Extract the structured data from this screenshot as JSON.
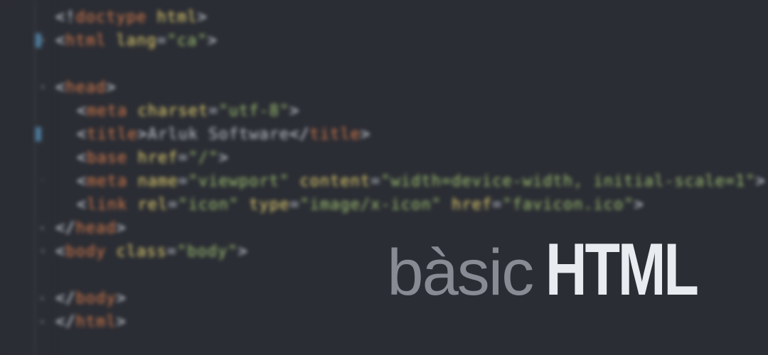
{
  "overlay": {
    "word1": "bàsic",
    "word2": "HTML"
  },
  "code": {
    "lines": [
      {
        "indent": 0,
        "segments": [
          {
            "cls": "bracket",
            "t": "<!"
          },
          {
            "cls": "tag",
            "t": "doctype "
          },
          {
            "cls": "attr-name",
            "t": "html"
          },
          {
            "cls": "bracket",
            "t": ">"
          }
        ]
      },
      {
        "indent": 0,
        "segments": [
          {
            "cls": "bracket",
            "t": "<"
          },
          {
            "cls": "tag",
            "t": "html "
          },
          {
            "cls": "attr-name",
            "t": "lang"
          },
          {
            "cls": "attr-eq",
            "t": "="
          },
          {
            "cls": "attr-val",
            "t": "\"ca\""
          },
          {
            "cls": "bracket",
            "t": ">"
          }
        ]
      },
      {
        "indent": 0,
        "segments": []
      },
      {
        "indent": 0,
        "segments": [
          {
            "cls": "bracket",
            "t": "<"
          },
          {
            "cls": "tag",
            "t": "head"
          },
          {
            "cls": "bracket",
            "t": ">"
          }
        ]
      },
      {
        "indent": 1,
        "segments": [
          {
            "cls": "bracket",
            "t": "<"
          },
          {
            "cls": "tag",
            "t": "meta "
          },
          {
            "cls": "attr-name",
            "t": "charset"
          },
          {
            "cls": "attr-eq",
            "t": "="
          },
          {
            "cls": "attr-val",
            "t": "\"utf-8\""
          },
          {
            "cls": "bracket",
            "t": ">"
          }
        ]
      },
      {
        "indent": 1,
        "segments": [
          {
            "cls": "bracket",
            "t": "<"
          },
          {
            "cls": "tag",
            "t": "title"
          },
          {
            "cls": "bracket",
            "t": ">"
          },
          {
            "cls": "text-content",
            "t": "Arluk Software"
          },
          {
            "cls": "bracket",
            "t": "</"
          },
          {
            "cls": "tag",
            "t": "title"
          },
          {
            "cls": "bracket",
            "t": ">"
          }
        ]
      },
      {
        "indent": 1,
        "segments": [
          {
            "cls": "bracket",
            "t": "<"
          },
          {
            "cls": "tag",
            "t": "base "
          },
          {
            "cls": "attr-name",
            "t": "href"
          },
          {
            "cls": "attr-eq",
            "t": "="
          },
          {
            "cls": "attr-val",
            "t": "\"/\""
          },
          {
            "cls": "bracket",
            "t": ">"
          }
        ]
      },
      {
        "indent": 1,
        "segments": [
          {
            "cls": "bracket",
            "t": "<"
          },
          {
            "cls": "tag",
            "t": "meta "
          },
          {
            "cls": "attr-name",
            "t": "name"
          },
          {
            "cls": "attr-eq",
            "t": "="
          },
          {
            "cls": "attr-val",
            "t": "\"viewport\" "
          },
          {
            "cls": "attr-name",
            "t": "content"
          },
          {
            "cls": "attr-eq",
            "t": "="
          },
          {
            "cls": "attr-val",
            "t": "\"width=device-width, initial-scale=1\""
          },
          {
            "cls": "bracket",
            "t": ">"
          }
        ]
      },
      {
        "indent": 1,
        "segments": [
          {
            "cls": "bracket",
            "t": "<"
          },
          {
            "cls": "tag",
            "t": "link "
          },
          {
            "cls": "attr-name",
            "t": "rel"
          },
          {
            "cls": "attr-eq",
            "t": "="
          },
          {
            "cls": "attr-val",
            "t": "\"icon\" "
          },
          {
            "cls": "attr-name",
            "t": "type"
          },
          {
            "cls": "attr-eq",
            "t": "="
          },
          {
            "cls": "attr-val",
            "t": "\"image/x-icon\" "
          },
          {
            "cls": "attr-name",
            "t": "href"
          },
          {
            "cls": "attr-eq",
            "t": "="
          },
          {
            "cls": "attr-val",
            "t": "\"favicon.ico\""
          },
          {
            "cls": "bracket",
            "t": ">"
          }
        ]
      },
      {
        "indent": 0,
        "segments": [
          {
            "cls": "bracket",
            "t": "</"
          },
          {
            "cls": "tag",
            "t": "head"
          },
          {
            "cls": "bracket",
            "t": ">"
          }
        ]
      },
      {
        "indent": 0,
        "segments": [
          {
            "cls": "bracket",
            "t": "<"
          },
          {
            "cls": "tag",
            "t": "body "
          },
          {
            "cls": "attr-name",
            "t": "class"
          },
          {
            "cls": "attr-eq",
            "t": "="
          },
          {
            "cls": "attr-val",
            "t": "\"body\""
          },
          {
            "cls": "bracket",
            "t": ">"
          }
        ]
      },
      {
        "indent": 0,
        "segments": []
      },
      {
        "indent": 0,
        "segments": [
          {
            "cls": "bracket",
            "t": "</"
          },
          {
            "cls": "tag",
            "t": "body"
          },
          {
            "cls": "bracket",
            "t": ">"
          }
        ]
      },
      {
        "indent": 0,
        "segments": [
          {
            "cls": "bracket",
            "t": "</"
          },
          {
            "cls": "tag",
            "t": "html"
          },
          {
            "cls": "bracket",
            "t": ">"
          }
        ]
      }
    ]
  },
  "fold_markers": [
    {
      "line": 1,
      "type": "open"
    },
    {
      "line": 3,
      "type": "open"
    },
    {
      "line": 7,
      "type": "marker"
    },
    {
      "line": 9,
      "type": "close"
    },
    {
      "line": 10,
      "type": "open"
    },
    {
      "line": 12,
      "type": "close"
    },
    {
      "line": 13,
      "type": "close"
    }
  ],
  "highlight_markers": [
    1,
    5
  ]
}
